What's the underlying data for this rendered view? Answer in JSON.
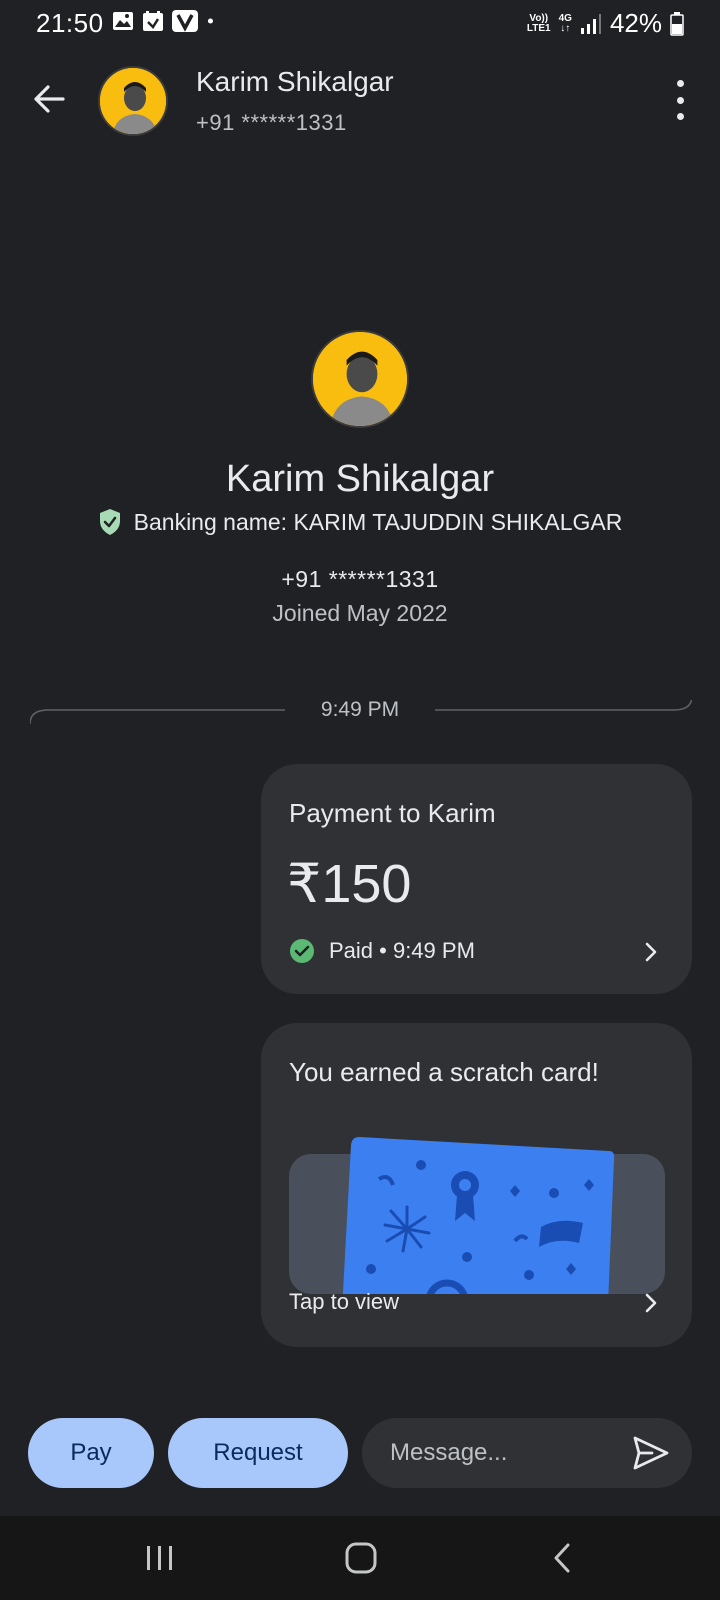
{
  "status_bar": {
    "time": "21:50",
    "volte_label_top": "Vo))",
    "volte_label_bottom": "LTE1",
    "network_top": "4G",
    "network_bottom": "↓↑",
    "battery": "42%",
    "notification_icons": [
      "gallery-icon",
      "calendar-icon",
      "v-app-icon",
      "dot-icon"
    ]
  },
  "header": {
    "contact_name": "Karim Shikalgar",
    "contact_phone": "+91 ******1331"
  },
  "profile": {
    "name": "Karim Shikalgar",
    "banking_name": "Banking name: KARIM TAJUDDIN SHIKALGAR",
    "phone": "+91 ******1331",
    "joined": "Joined May 2022"
  },
  "conversation": {
    "timestamp": "9:49 PM",
    "payment_card": {
      "title": "Payment to Karim",
      "amount": "₹150",
      "status": "Paid • 9:49 PM"
    },
    "scratch_card": {
      "title": "You earned a scratch card!",
      "action": "Tap to view"
    }
  },
  "composer": {
    "pay_label": "Pay",
    "request_label": "Request",
    "message_placeholder": "Message..."
  },
  "colors": {
    "background": "#202124",
    "card": "#303134",
    "accent_button": "#a8c7fa",
    "success_green": "#5bb974",
    "avatar_bg": "#f9bd0f",
    "scratch_blue": "#3c7ff0"
  }
}
